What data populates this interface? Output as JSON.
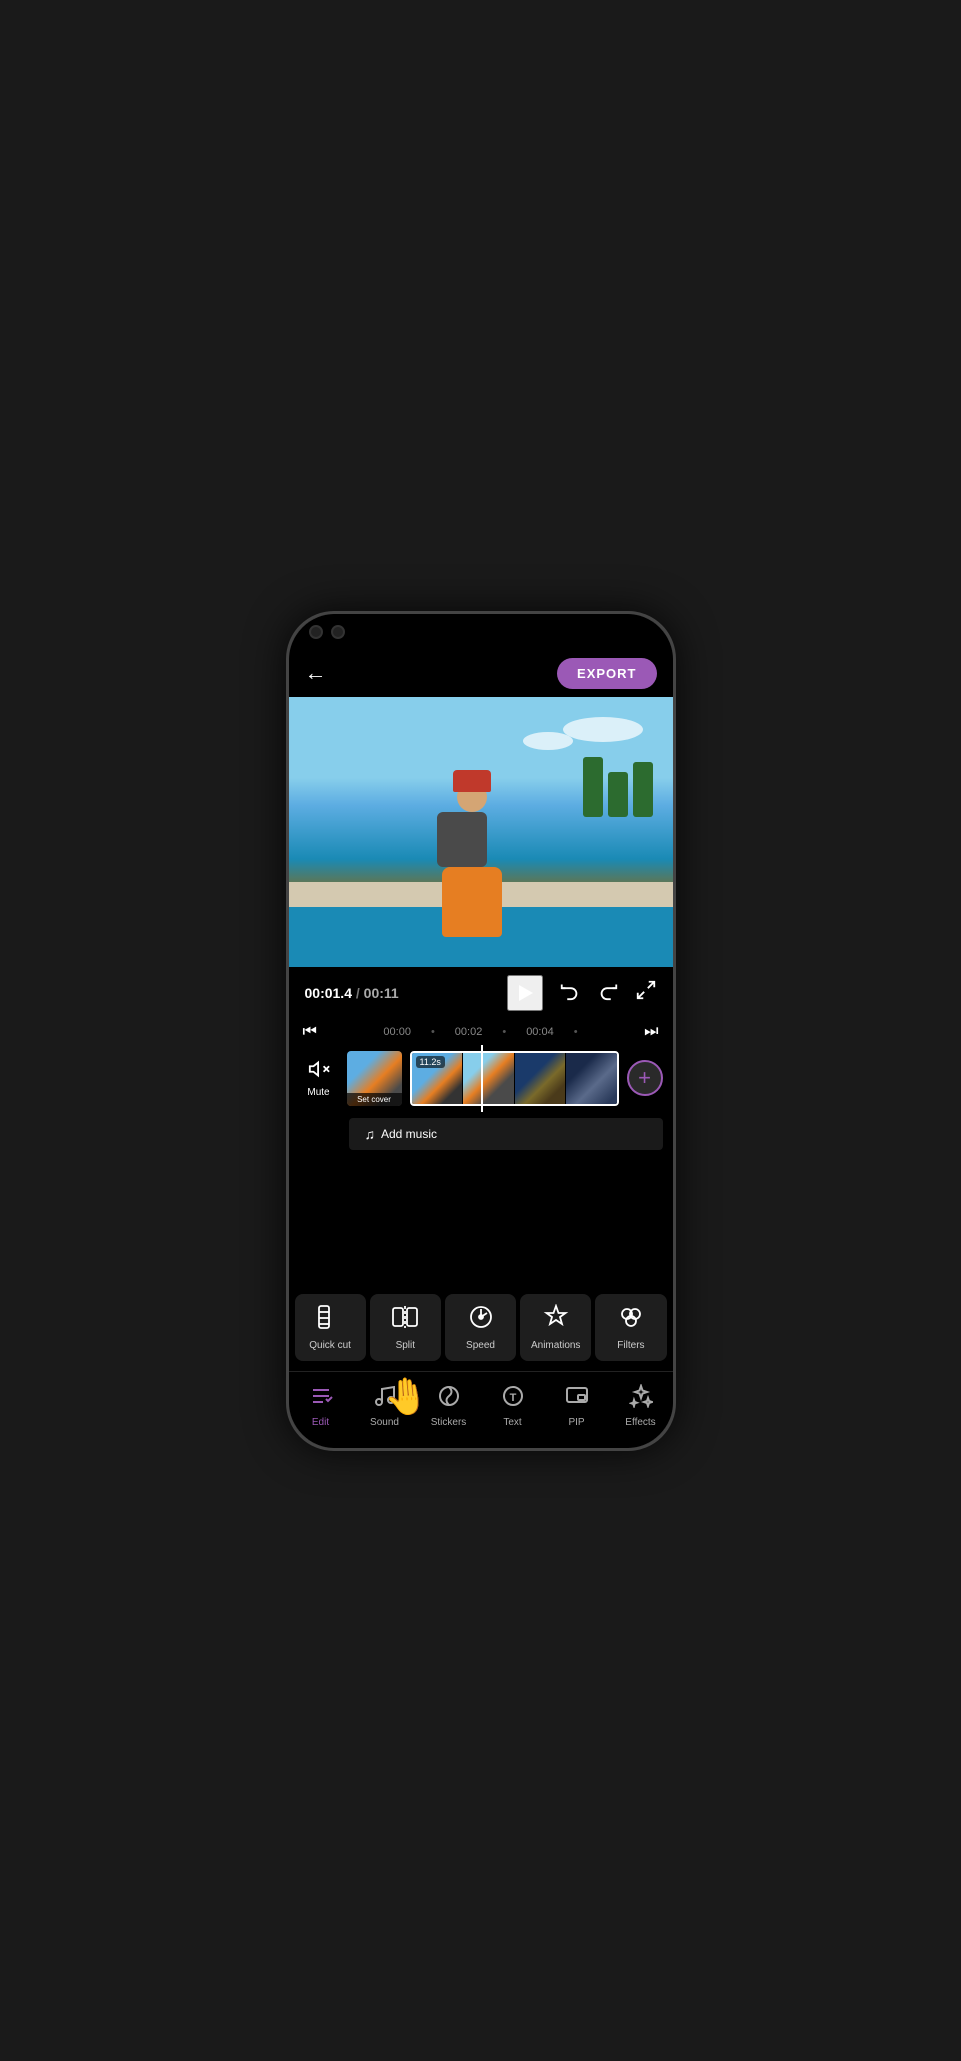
{
  "phone": {
    "header": {
      "back_label": "←",
      "export_label": "EXPORT"
    },
    "video": {
      "current_time": "00:01.4",
      "separator": "/",
      "total_time": "00:11"
    },
    "timeline": {
      "markers": [
        "00:00",
        "00:02",
        "00:04"
      ],
      "clip_duration": "11.2s",
      "set_cover_label": "Set cover",
      "add_music_label": "Add music",
      "mute_label": "Mute"
    },
    "tools": [
      {
        "id": "quick-cut",
        "label": "Quick cut",
        "icon": "⊞"
      },
      {
        "id": "split",
        "label": "Split",
        "icon": "⊡"
      },
      {
        "id": "speed",
        "label": "Speed",
        "icon": "⏱"
      },
      {
        "id": "animations",
        "label": "Animations",
        "icon": "✦"
      },
      {
        "id": "filters",
        "label": "Filters",
        "icon": "⚘"
      }
    ],
    "nav": [
      {
        "id": "edit",
        "label": "Edit",
        "active": true
      },
      {
        "id": "sound",
        "label": "Sound",
        "active": false
      },
      {
        "id": "stickers",
        "label": "Stickers",
        "active": false
      },
      {
        "id": "text",
        "label": "Text",
        "active": false
      },
      {
        "id": "pip",
        "label": "PIP",
        "active": false
      },
      {
        "id": "effects",
        "label": "Effects",
        "active": false
      }
    ],
    "colors": {
      "accent": "#9B59B6",
      "background": "#000000",
      "surface": "#1e1e1e",
      "text_primary": "#ffffff",
      "text_secondary": "#aaaaaa"
    }
  }
}
